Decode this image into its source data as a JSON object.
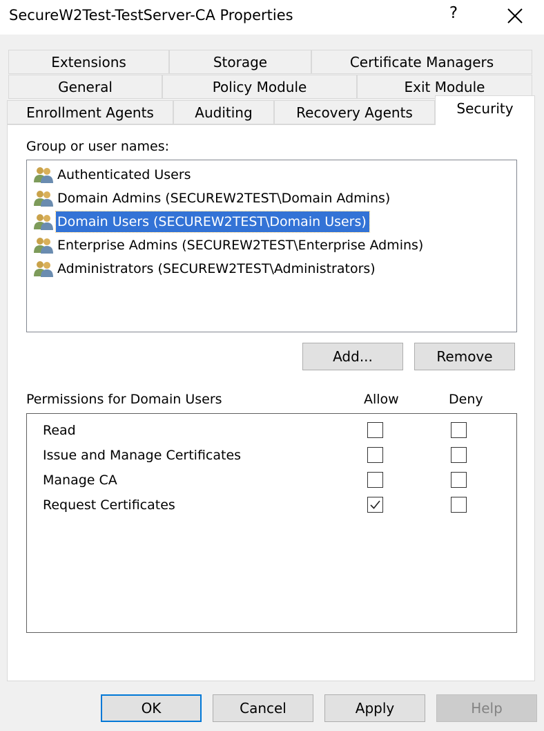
{
  "window": {
    "title": "SecureW2Test-TestServer-CA Properties",
    "help_label": "?"
  },
  "tabs": {
    "row1": [
      "Extensions",
      "Storage",
      "Certificate Managers"
    ],
    "row2": [
      "General",
      "Policy Module",
      "Exit Module"
    ],
    "row3": [
      "Enrollment Agents",
      "Auditing",
      "Recovery Agents",
      "Security"
    ],
    "active": "Security"
  },
  "security": {
    "group_label": "Group or user names:",
    "users": [
      "Authenticated Users",
      "Domain Admins (SECUREW2TEST\\Domain Admins)",
      "Domain Users (SECUREW2TEST\\Domain Users)",
      "Enterprise Admins (SECUREW2TEST\\Enterprise Admins)",
      "Administrators (SECUREW2TEST\\Administrators)"
    ],
    "selected_user": "Domain Users (SECUREW2TEST\\Domain Users)",
    "add_label": "Add...",
    "remove_label": "Remove",
    "permissions_label": "Permissions for Domain Users",
    "allow_label": "Allow",
    "deny_label": "Deny",
    "permissions": [
      {
        "name": "Read",
        "allow": false,
        "deny": false
      },
      {
        "name": "Issue and Manage Certificates",
        "allow": false,
        "deny": false
      },
      {
        "name": "Manage CA",
        "allow": false,
        "deny": false
      },
      {
        "name": "Request Certificates",
        "allow": true,
        "deny": false
      }
    ]
  },
  "footer": {
    "ok": "OK",
    "cancel": "Cancel",
    "apply": "Apply",
    "help": "Help"
  },
  "icons": {
    "user": "users-group-icon",
    "close": "close-icon"
  },
  "colors": {
    "selection": "#3373d6",
    "default_button_border": "#0078d7"
  }
}
